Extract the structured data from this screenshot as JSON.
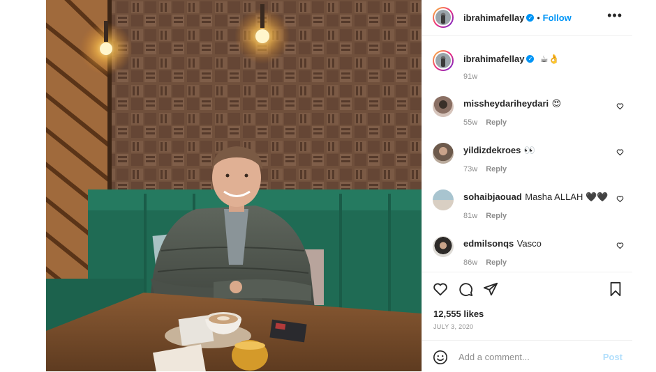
{
  "post": {
    "username": "ibrahimafellay",
    "follow_label": "Follow",
    "separator": "•",
    "more_label": "•••",
    "caption_emoji": "☕👌",
    "caption_age": "91w"
  },
  "comments": [
    {
      "username": "missheydariheydari",
      "text": "😍",
      "age": "55w",
      "reply_label": "Reply"
    },
    {
      "username": "yildizdekroes",
      "text": "👀",
      "age": "73w",
      "reply_label": "Reply"
    },
    {
      "username": "sohaibjaouad",
      "text": "Masha ALLAH 🖤🖤",
      "age": "81w",
      "reply_label": "Reply"
    },
    {
      "username": "edmilsonqs",
      "text": "Vasco",
      "age": "86w",
      "reply_label": "Reply"
    }
  ],
  "engagement": {
    "likes": "12,555 likes",
    "date": "JULY 3, 2020"
  },
  "composer": {
    "placeholder": "Add a comment...",
    "post_label": "Post"
  },
  "icons": {
    "like": "heart-icon",
    "comment": "comment-bubble-icon",
    "share": "paper-plane-icon",
    "save": "bookmark-icon",
    "emoji": "smiley-icon",
    "verified": "verified-badge-icon"
  },
  "colors": {
    "accent": "#0095f6",
    "text": "#262626",
    "muted": "#8e8e8e",
    "post_disabled": "#b2dffc"
  }
}
